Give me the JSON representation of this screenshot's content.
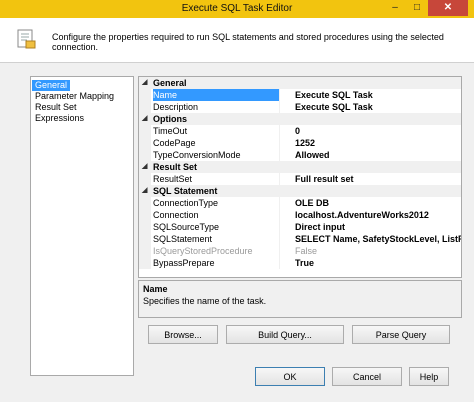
{
  "window": {
    "title": "Execute SQL Task Editor",
    "minimize": "–",
    "maximize": "□",
    "close": "✕"
  },
  "header": {
    "description": "Configure the properties required to run SQL statements and stored procedures using the selected connection."
  },
  "nav": {
    "items": [
      "General",
      "Parameter Mapping",
      "Result Set",
      "Expressions"
    ],
    "selected": "General"
  },
  "properties": {
    "categories": [
      {
        "name": "General",
        "rows": [
          {
            "name": "Name",
            "value": "Execute SQL Task"
          },
          {
            "name": "Description",
            "value": "Execute SQL Task"
          }
        ]
      },
      {
        "name": "Options",
        "rows": [
          {
            "name": "TimeOut",
            "value": "0"
          },
          {
            "name": "CodePage",
            "value": "1252"
          },
          {
            "name": "TypeConversionMode",
            "value": "Allowed"
          }
        ]
      },
      {
        "name": "Result Set",
        "rows": [
          {
            "name": "ResultSet",
            "value": "Full result set"
          }
        ]
      },
      {
        "name": "SQL Statement",
        "rows": [
          {
            "name": "ConnectionType",
            "value": "OLE DB"
          },
          {
            "name": "Connection",
            "value": "localhost.AdventureWorks2012"
          },
          {
            "name": "SQLSourceType",
            "value": "Direct input"
          },
          {
            "name": "SQLStatement",
            "value": "SELECT Name, SafetyStockLevel, ListPriceFrom"
          },
          {
            "name": "IsQueryStoredProcedure",
            "value": "False"
          },
          {
            "name": "BypassPrepare",
            "value": "True"
          }
        ]
      }
    ]
  },
  "help": {
    "title": "Name",
    "text": "Specifies the name of the task."
  },
  "buttons": {
    "browse": "Browse...",
    "build_query": "Build Query...",
    "parse_query": "Parse Query",
    "ok": "OK",
    "cancel": "Cancel",
    "help": "Help"
  },
  "colors": {
    "titlebar": "#f2c40f",
    "selection": "#3399ff",
    "close": "#c7473a"
  }
}
